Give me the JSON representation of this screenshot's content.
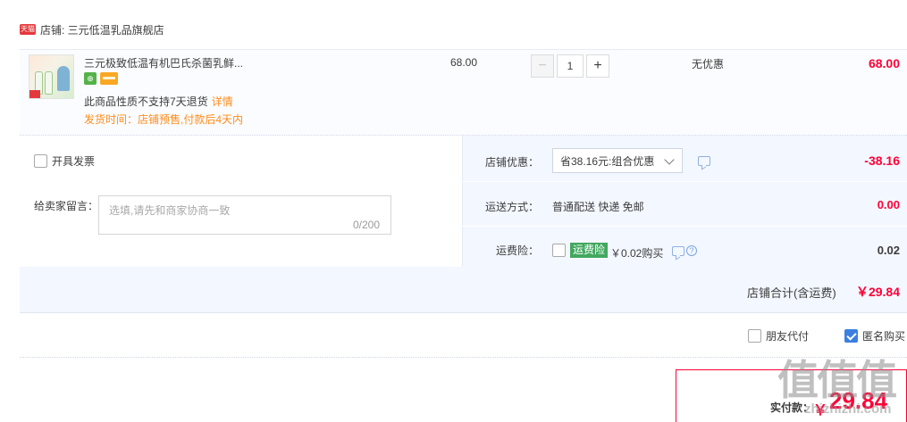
{
  "store": {
    "badge": "天猫",
    "label": "店铺: 三元低温乳品旗舰店"
  },
  "item": {
    "title": "三元极致低温有机巴氏杀菌乳鲜...",
    "notice": "此商品性质不支持7天退货",
    "detail_link": "详情",
    "ship_time": "发货时间：店铺预售,付款后4天内",
    "price": "68.00",
    "quantity": "1",
    "qty_minus": "−",
    "qty_plus": "+",
    "discount": "无优惠",
    "subtotal": "68.00"
  },
  "options": {
    "invoice_label": "开具发票",
    "message_label": "给卖家留言：",
    "message_placeholder": "选填,请先和商家协商一致",
    "message_count": "0/200",
    "shop_discount_label": "店铺优惠：",
    "shop_discount_selected": "省38.16元:组合优惠",
    "shop_discount_amount": "-38.16",
    "shipping_label": "运送方式：",
    "shipping_value": "普通配送 快递 免邮",
    "shipping_amount": "0.00",
    "insurance_label": "运费险：",
    "insurance_badge": "运费险",
    "insurance_price": "￥0.02购买",
    "insurance_amount": "0.02",
    "total_label": "店铺合计(含运费)",
    "total_value": "￥29.84"
  },
  "bottom": {
    "friend_pay": "朋友代付",
    "anonymous": "匿名购买",
    "anonymous_checked": true
  },
  "pay": {
    "label": "实付款：",
    "currency": "￥",
    "value": "29.84"
  },
  "watermark": {
    "mark": "值值值",
    "site": "zhizhizhi.com"
  },
  "colors": {
    "price_red": "#ff0036",
    "notice_orange": "#ff8c1a",
    "panel_blue": "#f3f7ff",
    "insurance_green": "#41a85f",
    "check_blue": "#3b7fe0"
  }
}
